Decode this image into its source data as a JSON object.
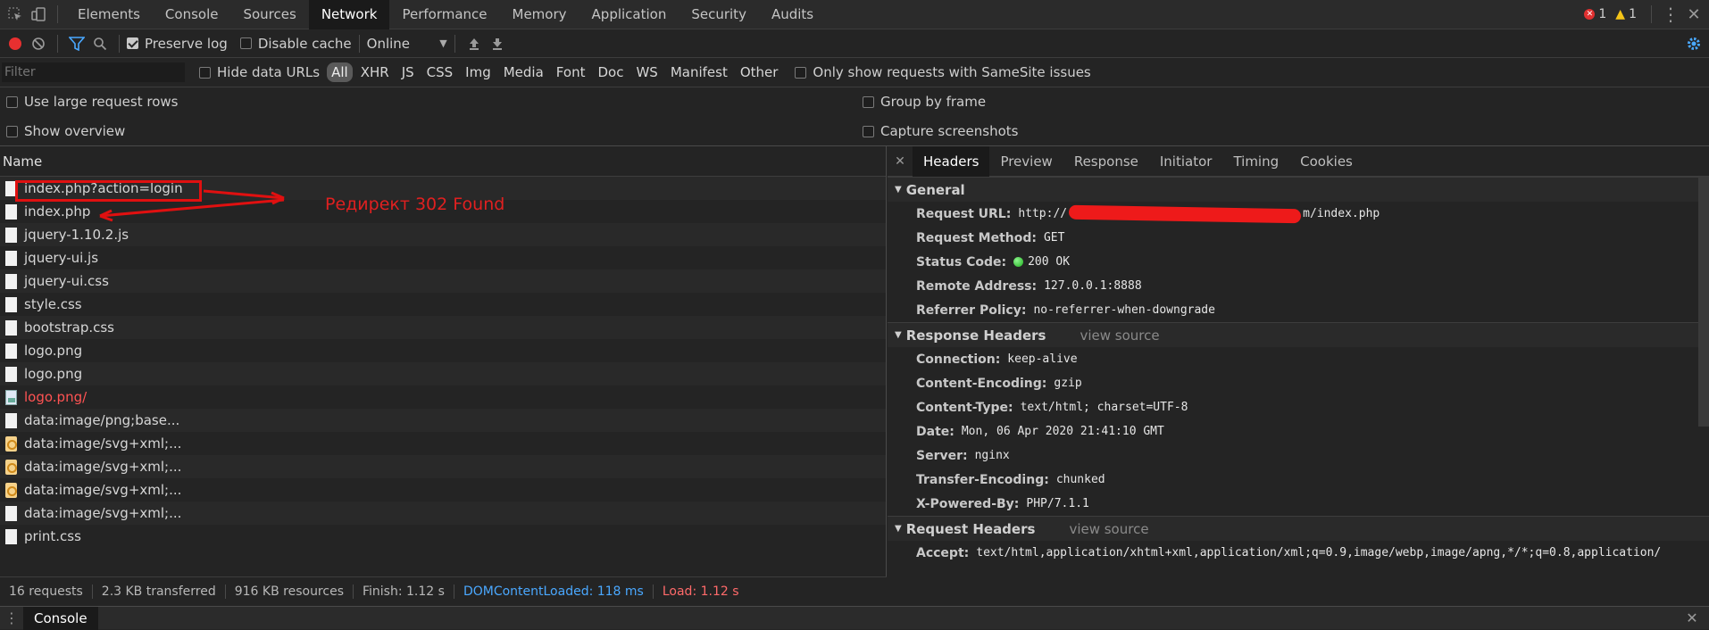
{
  "top_tabs": [
    "Elements",
    "Console",
    "Sources",
    "Network",
    "Performance",
    "Memory",
    "Application",
    "Security",
    "Audits"
  ],
  "active_top_tab": "Network",
  "counts": {
    "errors": "1",
    "warnings": "1"
  },
  "toolbar": {
    "preserve_log": "Preserve log",
    "disable_cache": "Disable cache",
    "throttle": "Online"
  },
  "filter": {
    "placeholder": "Filter",
    "hide_data_urls": "Hide data URLs",
    "types": [
      "All",
      "XHR",
      "JS",
      "CSS",
      "Img",
      "Media",
      "Font",
      "Doc",
      "WS",
      "Manifest",
      "Other"
    ],
    "samesite": "Only show requests with SameSite issues"
  },
  "options": {
    "large_rows": "Use large request rows",
    "show_overview": "Show overview",
    "group_by_frame": "Group by frame",
    "capture_screenshots": "Capture screenshots"
  },
  "requests_header": "Name",
  "requests": [
    {
      "name": "index.php?action=login",
      "icon": "file"
    },
    {
      "name": "index.php",
      "icon": "file"
    },
    {
      "name": "jquery-1.10.2.js",
      "icon": "file"
    },
    {
      "name": "jquery-ui.js",
      "icon": "file"
    },
    {
      "name": "jquery-ui.css",
      "icon": "file"
    },
    {
      "name": "style.css",
      "icon": "file"
    },
    {
      "name": "bootstrap.css",
      "icon": "file"
    },
    {
      "name": "logo.png",
      "icon": "file"
    },
    {
      "name": "logo.png",
      "icon": "file"
    },
    {
      "name": "logo.png/",
      "icon": "broken-image",
      "error": true
    },
    {
      "name": "data:image/png;base...",
      "icon": "file"
    },
    {
      "name": "data:image/svg+xml;...",
      "icon": "svg"
    },
    {
      "name": "data:image/svg+xml;...",
      "icon": "svg"
    },
    {
      "name": "data:image/svg+xml;...",
      "icon": "svg"
    },
    {
      "name": "data:image/svg+xml;...",
      "icon": "file"
    },
    {
      "name": "print.css",
      "icon": "file"
    }
  ],
  "annotation": "Редирект 302 Found",
  "status": {
    "requests": "16 requests",
    "transferred": "2.3 KB transferred",
    "resources": "916 KB resources",
    "finish": "Finish: 1.12 s",
    "dom": "DOMContentLoaded: 118 ms",
    "load": "Load: 1.12 s"
  },
  "detail_tabs": [
    "Headers",
    "Preview",
    "Response",
    "Initiator",
    "Timing",
    "Cookies"
  ],
  "active_detail_tab": "Headers",
  "general": {
    "title": "General",
    "rows": [
      {
        "key": "Request URL:",
        "value": "http://",
        "value_tail": "m/index.php"
      },
      {
        "key": "Request Method:",
        "value": "GET"
      },
      {
        "key": "Status Code:",
        "value": "200 OK",
        "dot": true
      },
      {
        "key": "Remote Address:",
        "value": "127.0.0.1:8888"
      },
      {
        "key": "Referrer Policy:",
        "value": "no-referrer-when-downgrade"
      }
    ]
  },
  "response_headers": {
    "title": "Response Headers",
    "view_source": "view source",
    "rows": [
      {
        "key": "Connection:",
        "value": "keep-alive"
      },
      {
        "key": "Content-Encoding:",
        "value": "gzip"
      },
      {
        "key": "Content-Type:",
        "value": "text/html; charset=UTF-8"
      },
      {
        "key": "Date:",
        "value": "Mon, 06 Apr 2020 21:41:10 GMT"
      },
      {
        "key": "Server:",
        "value": "nginx"
      },
      {
        "key": "Transfer-Encoding:",
        "value": "chunked"
      },
      {
        "key": "X-Powered-By:",
        "value": "PHP/7.1.1"
      }
    ]
  },
  "request_headers": {
    "title": "Request Headers",
    "view_source": "view source",
    "rows": [
      {
        "key": "Accept:",
        "value": "text/html,application/xhtml+xml,application/xml;q=0.9,image/webp,image/apng,*/*;q=0.8,application/"
      }
    ]
  },
  "console_tab": "Console",
  "colors": {
    "accent": "#4aa8ff",
    "error": "#ff5353",
    "record": "#e83030"
  }
}
